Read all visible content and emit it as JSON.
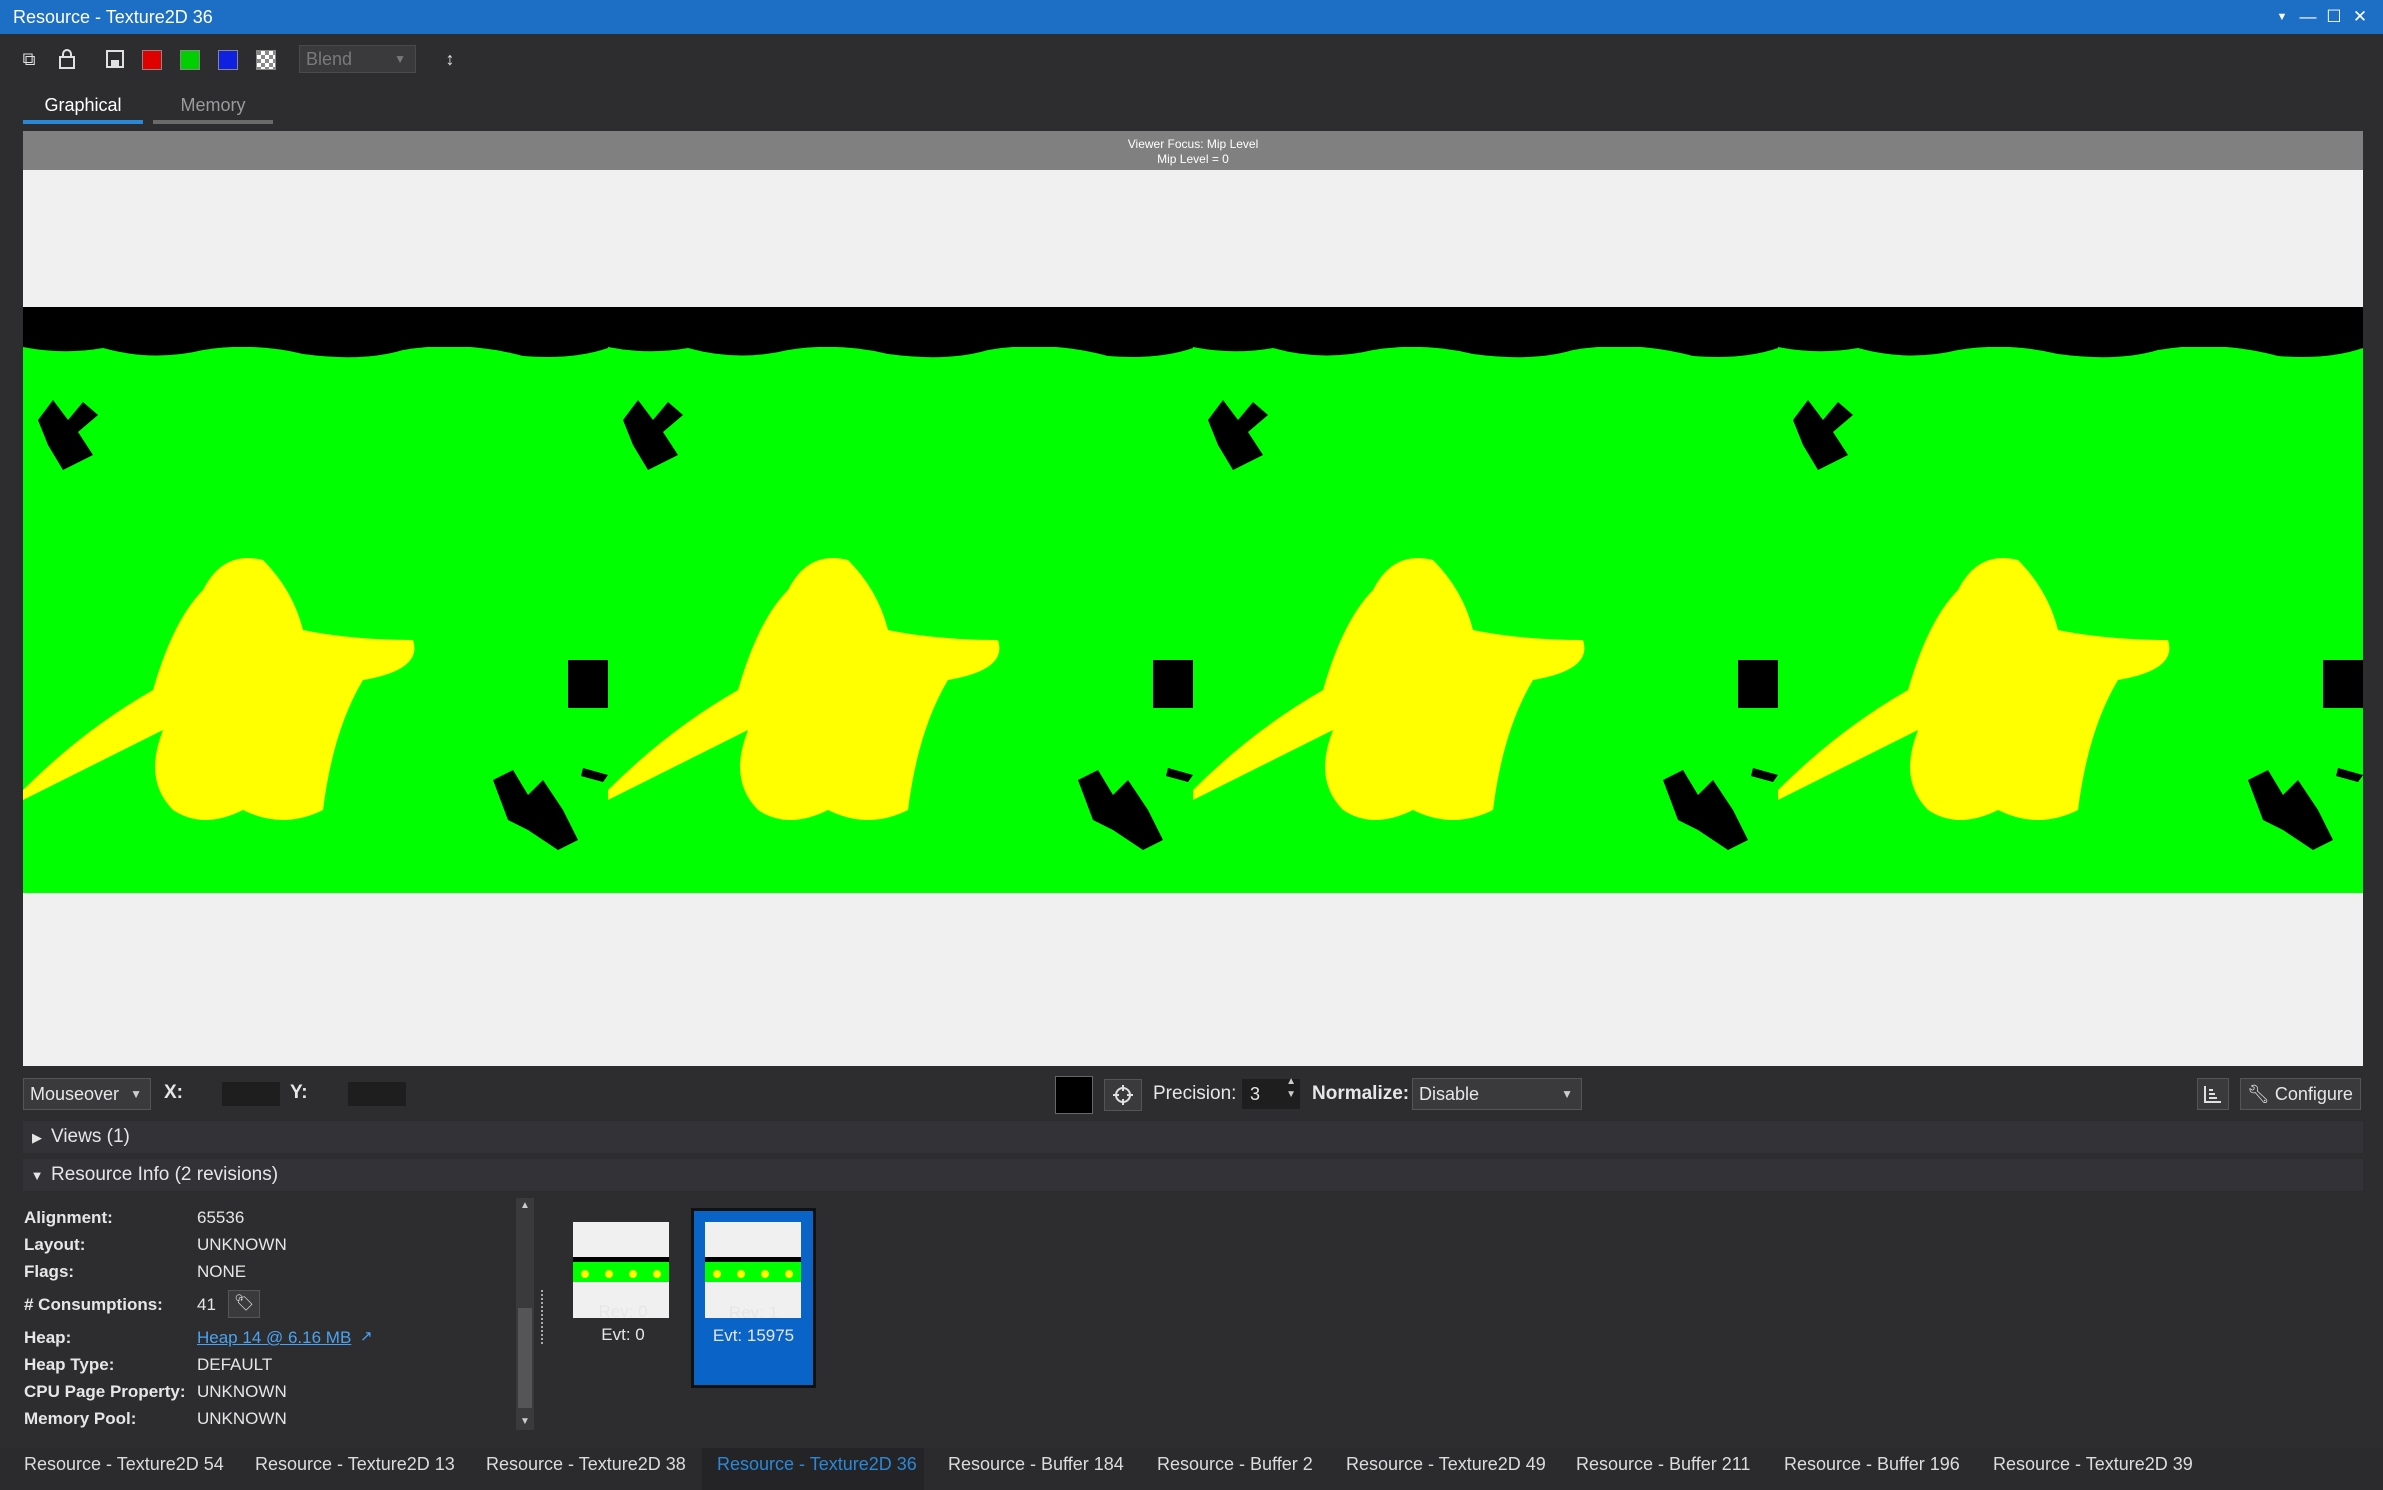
{
  "window": {
    "title": "Resource - Texture2D 36"
  },
  "toolbar": {
    "blend_label": "Blend",
    "channel_colors": {
      "red": "#e00000",
      "green": "#00d000",
      "blue": "#1020e0"
    }
  },
  "tabs": [
    {
      "label": "Graphical",
      "active": true
    },
    {
      "label": "Memory",
      "active": false
    }
  ],
  "viewer": {
    "focus_line1": "Viewer Focus: Mip Level",
    "focus_line2": "Mip Level = 0",
    "colors": {
      "background": "#f0f0f0",
      "band": "#00ff00",
      "shape": "#ffff00",
      "dark": "#000000"
    }
  },
  "controls": {
    "mode": "Mouseover",
    "x_label": "X:",
    "y_label": "Y:",
    "precision_label": "Precision:",
    "precision_value": "3",
    "normalize_label": "Normalize:",
    "normalize_value": "Disable",
    "configure_label": "Configure"
  },
  "sections": {
    "views": "Views (1)",
    "resource_info": "Resource Info (2 revisions)"
  },
  "resource_info": [
    {
      "key": "Alignment:",
      "value": "65536"
    },
    {
      "key": "Layout:",
      "value": "UNKNOWN"
    },
    {
      "key": "Flags:",
      "value": "NONE"
    },
    {
      "key": "# Consumptions:",
      "value": "41"
    },
    {
      "key": "Heap:",
      "value": "Heap 14 @ 6.16 MB"
    },
    {
      "key": "Heap Type:",
      "value": "DEFAULT"
    },
    {
      "key": "CPU Page Property:",
      "value": "UNKNOWN"
    },
    {
      "key": "Memory Pool:",
      "value": "UNKNOWN"
    }
  ],
  "revisions": [
    {
      "rev": "Rev: 0",
      "evt": "Evt: 0",
      "selected": false
    },
    {
      "rev": "Rev: 1",
      "evt": "Evt: 15975",
      "selected": true
    }
  ],
  "document_tabs": [
    {
      "label": "Resource - Texture2D 54",
      "active": false
    },
    {
      "label": "Resource - Texture2D 13",
      "active": false
    },
    {
      "label": "Resource - Texture2D 38",
      "active": false
    },
    {
      "label": "Resource - Texture2D 36",
      "active": true
    },
    {
      "label": "Resource - Buffer 184",
      "active": false
    },
    {
      "label": "Resource - Buffer 2",
      "active": false
    },
    {
      "label": "Resource - Texture2D 49",
      "active": false
    },
    {
      "label": "Resource - Buffer 211",
      "active": false
    },
    {
      "label": "Resource - Buffer 196",
      "active": false
    },
    {
      "label": "Resource - Texture2D 39",
      "active": false
    }
  ]
}
